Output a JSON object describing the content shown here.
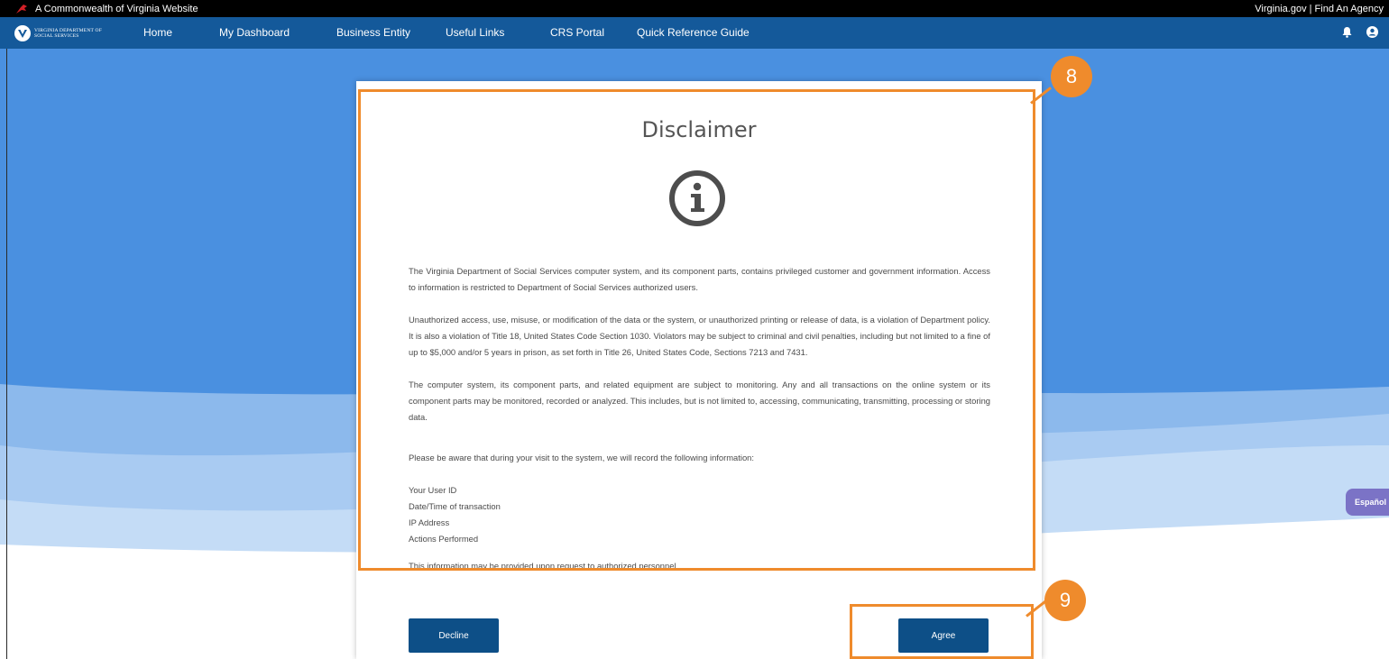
{
  "topbar": {
    "left_text": "A Commonwealth of Virginia Website",
    "right_text": "Virginia.gov | Find An Agency"
  },
  "nav": {
    "logo_line1": "VIRGINIA DEPARTMENT OF",
    "logo_line2": "SOCIAL SERVICES",
    "items": [
      "Home",
      "My Dashboard",
      "Business Entity",
      "Useful Links",
      "CRS Portal",
      "Quick Reference Guide"
    ]
  },
  "modal": {
    "title": "Disclaimer",
    "paragraphs": [
      "The Virginia Department of Social Services computer system, and its component parts, contains privileged customer and government information. Access to information is restricted to Department of Social Services authorized users.",
      "Unauthorized access, use, misuse, or modification of the data or the system, or unauthorized printing or release of data, is a violation of Department policy. It is also a violation of Title 18, United States Code Section 1030. Violators may be subject to criminal and civil penalties, including but not limited to a fine of up to $5,000 and/or 5 years in prison, as set forth in Title 26, United States Code, Sections 7213 and 7431.",
      "The computer system, its component parts, and related equipment are subject to monitoring. Any and all transactions on the online system or its component parts may be monitored, recorded or analyzed. This includes, but is not limited to, accessing, communicating, transmitting, processing or storing data."
    ],
    "record_intro": "Please be aware that during your visit to the system, we will record the following information:",
    "record_items": [
      "Your User ID",
      "Date/Time of transaction",
      "IP Address",
      "Actions Performed"
    ],
    "footer_note": "This information may be provided upon request to authorized personnel.",
    "decline_label": "Decline",
    "agree_label": "Agree"
  },
  "annotations": {
    "callout_8": "8",
    "callout_9": "9"
  },
  "espanol_label": "Español",
  "colors": {
    "accent_orange": "#ef8b2c",
    "nav_blue": "#14599a",
    "button_blue": "#0d4f87"
  }
}
